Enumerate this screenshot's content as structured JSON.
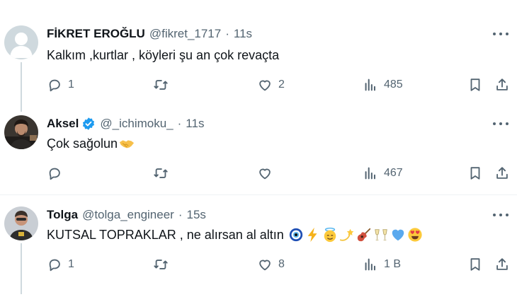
{
  "colors": {
    "text": "#0f1419",
    "muted": "#536471",
    "verified": "#1d9bf0",
    "line": "#cfd9de"
  },
  "tweets": [
    {
      "name": "FİKRET EROĞLU",
      "handle": "@fikret_1717",
      "dot": "·",
      "time": "11s",
      "verified": false,
      "avatar": "default-avatar",
      "text": "Kalkım ,kurtlar , köyleri şu an çok revaçta",
      "replies": "1",
      "retweets": "",
      "likes": "2",
      "views": "485"
    },
    {
      "name": "Aksel",
      "handle": "@_ichimoku_",
      "dot": "·",
      "time": "11s",
      "verified": true,
      "avatar": "photo-avatar",
      "text": "Çok sağolun",
      "text_emojis": [
        "handshake-emoji"
      ],
      "replies": "",
      "retweets": "",
      "likes": "",
      "views": "467"
    },
    {
      "name": "Tolga",
      "handle": "@tolga_engineer",
      "dot": "·",
      "time": "15s",
      "verified": false,
      "avatar": "photo-avatar",
      "text": "KUTSAL TOPRAKLAR , ne alırsan al altın",
      "text_emojis": [
        "nazar-emoji",
        "lightning-emoji",
        "halo-face-emoji",
        "dizzy-star-emoji",
        "guitar-emoji",
        "clinking-glasses-emoji",
        "blue-heart-emoji",
        "heart-eyes-emoji"
      ],
      "replies": "1",
      "retweets": "",
      "likes": "8",
      "views": "1 B"
    }
  ],
  "icons": [
    "reply-icon",
    "retweet-icon",
    "like-icon",
    "views-icon",
    "bookmark-icon",
    "share-icon",
    "more-icon"
  ]
}
